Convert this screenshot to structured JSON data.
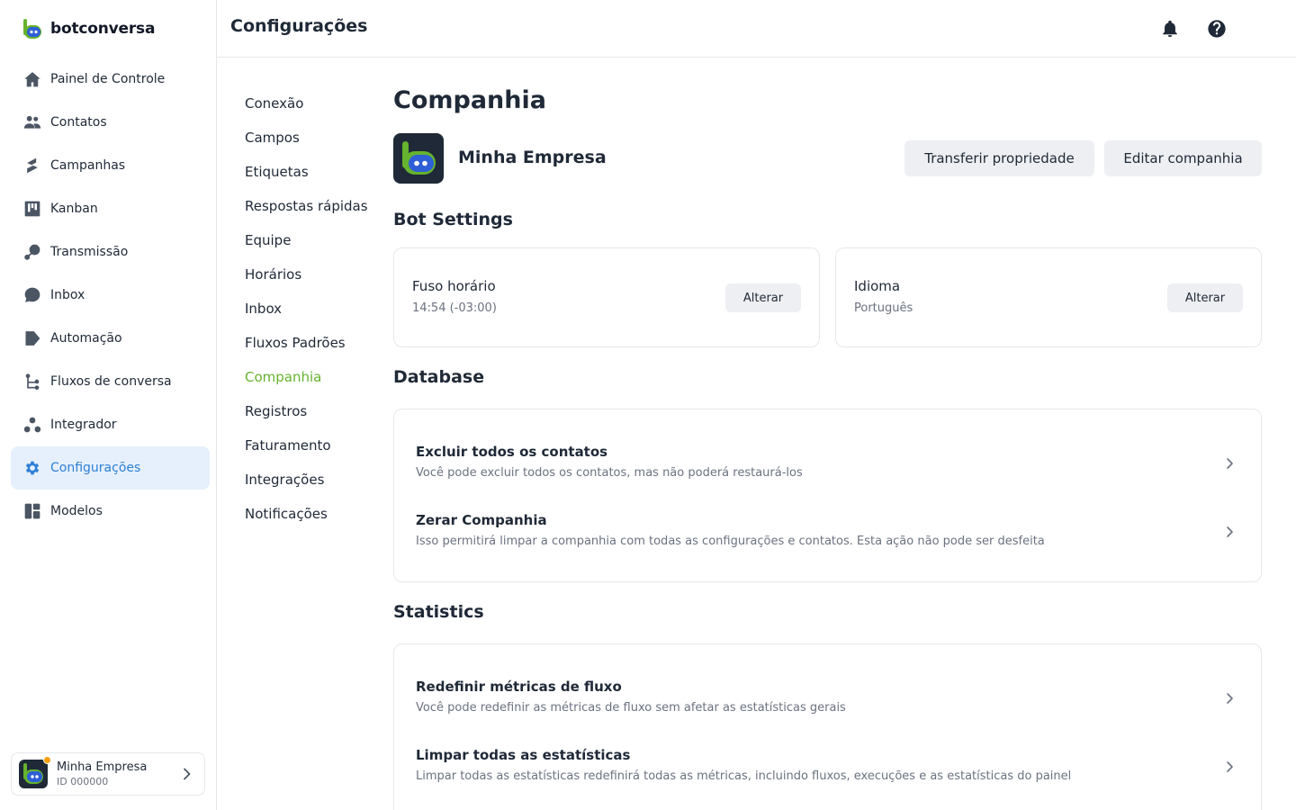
{
  "brand": {
    "name": "botconversa"
  },
  "sidebar": {
    "items": [
      {
        "label": "Painel de Controle",
        "icon": "home-icon"
      },
      {
        "label": "Contatos",
        "icon": "contacts-icon"
      },
      {
        "label": "Campanhas",
        "icon": "campaigns-icon"
      },
      {
        "label": "Kanban",
        "icon": "kanban-icon"
      },
      {
        "label": "Transmissão",
        "icon": "broadcast-icon"
      },
      {
        "label": "Inbox",
        "icon": "chat-icon"
      },
      {
        "label": "Automação",
        "icon": "automation-icon"
      },
      {
        "label": "Fluxos de conversa",
        "icon": "flow-icon"
      },
      {
        "label": "Integrador",
        "icon": "integrator-icon"
      },
      {
        "label": "Configurações",
        "icon": "gear-icon",
        "active": true
      },
      {
        "label": "Modelos",
        "icon": "templates-icon"
      }
    ],
    "account": {
      "name": "Minha Empresa",
      "id": "ID 000000"
    }
  },
  "header": {
    "title": "Configurações"
  },
  "submenu": {
    "items": [
      "Conexão",
      "Campos",
      "Etiquetas",
      "Respostas rápidas",
      "Equipe",
      "Horários",
      "Inbox",
      "Fluxos Padrões",
      "Companhia",
      "Registros",
      "Faturamento",
      "Integrações",
      "Notificações"
    ],
    "active": "Companhia"
  },
  "main": {
    "title": "Companhia",
    "company_name": "Minha Empresa",
    "transfer_label": "Transferir propriedade",
    "edit_label": "Editar companhia",
    "bot_settings": {
      "title": "Bot Settings",
      "timezone": {
        "label": "Fuso horário",
        "value": "14:54 (-03:00)",
        "button": "Alterar"
      },
      "language": {
        "label": "Idioma",
        "value": "Português",
        "button": "Alterar"
      }
    },
    "database": {
      "title": "Database",
      "rows": [
        {
          "title": "Excluir todos os contatos",
          "desc": "Você pode excluir todos os contatos, mas não poderá restaurá-los"
        },
        {
          "title": "Zerar Companhia",
          "desc": "Isso permitirá limpar a companhia com todas as configurações e contatos. Esta ação não pode ser desfeita"
        }
      ]
    },
    "statistics": {
      "title": "Statistics",
      "rows": [
        {
          "title": "Redefinir métricas de fluxo",
          "desc": "Você pode redefinir as métricas de fluxo sem afetar as estatísticas gerais"
        },
        {
          "title": "Limpar todas as estatísticas",
          "desc": "Limpar todas as estatísticas redefinirá todas as métricas, incluindo fluxos, execuções e as estatísticas do painel"
        }
      ]
    }
  },
  "colors": {
    "accent_blue": "#2f80d6",
    "accent_green": "#65b32e",
    "active_bg": "#e6f0fc"
  }
}
